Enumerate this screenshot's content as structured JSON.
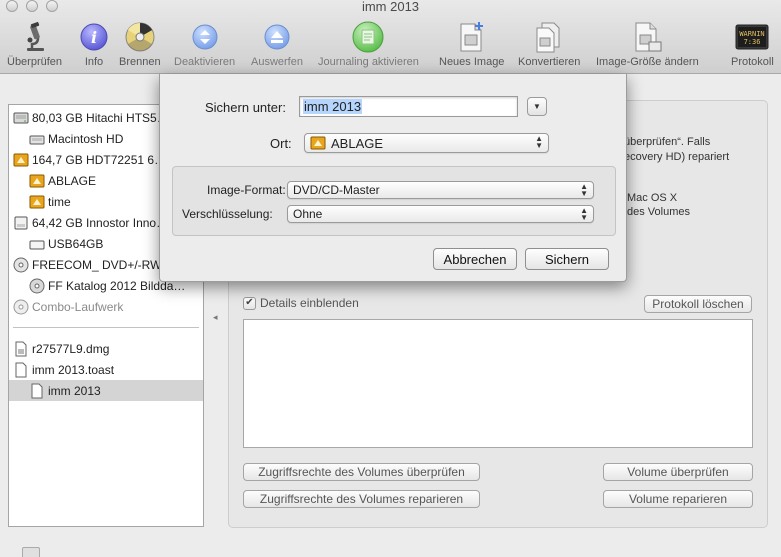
{
  "window": {
    "title": "imm 2013"
  },
  "toolbar": {
    "items": [
      {
        "label": "Überprüfen",
        "icon": "microscope-icon"
      },
      {
        "label": "Info",
        "icon": "info-icon"
      },
      {
        "label": "Brennen",
        "icon": "burn-icon"
      },
      {
        "label": "Deaktivieren",
        "icon": "unmount-icon"
      },
      {
        "label": "Auswerfen",
        "icon": "eject-icon"
      },
      {
        "label": "Journaling aktivieren",
        "icon": "journaling-icon"
      },
      {
        "label": "Neues Image",
        "icon": "new-image-icon"
      },
      {
        "label": "Konvertieren",
        "icon": "convert-icon"
      },
      {
        "label": "Image-Größe ändern",
        "icon": "resize-image-icon"
      },
      {
        "label": "Protokoll",
        "icon": "log-icon",
        "icon_text": "WARNIN\n7:36"
      }
    ]
  },
  "sidebar": {
    "items": [
      {
        "label": "80,03 GB Hitachi HTS5…",
        "icon": "internal-disk-icon"
      },
      {
        "label": "Macintosh HD",
        "icon": "volume-icon"
      },
      {
        "label": "164,7 GB HDT72251 6…",
        "icon": "external-disk-icon"
      },
      {
        "label": "ABLAGE",
        "icon": "external-volume-icon"
      },
      {
        "label": "time",
        "icon": "external-volume-icon"
      },
      {
        "label": "64,42 GB Innostor Inno…",
        "icon": "usb-disk-icon"
      },
      {
        "label": "USB64GB",
        "icon": "volume-icon"
      },
      {
        "label": "FREECOM_ DVD+/-RW…",
        "icon": "optical-drive-icon"
      },
      {
        "label": "FF Katalog 2012 Bildda…",
        "icon": "disc-icon"
      },
      {
        "label": "Combo-Laufwerk",
        "icon": "optical-drive-icon"
      },
      {
        "label": "r27577L9.dmg",
        "icon": "dmg-file-icon"
      },
      {
        "label": "imm 2013.toast",
        "icon": "disk-image-icon"
      },
      {
        "label": "imm 2013",
        "icon": "volume-icon"
      }
    ]
  },
  "main": {
    "background_lines": [
      "überprüfen“. Falls",
      "ecovery HD) repariert",
      "Mac OS X",
      "des Volumes"
    ],
    "details_checkbox": {
      "label": "Details einblenden",
      "checked": true
    },
    "clear_log_button": "Protokoll löschen",
    "buttons": {
      "verify_permissions": "Zugriffsrechte des Volumes überprüfen",
      "repair_permissions": "Zugriffsrechte des Volumes reparieren",
      "verify_volume": "Volume überprüfen",
      "repair_volume": "Volume reparieren"
    }
  },
  "save_sheet": {
    "save_as_label": "Sichern unter:",
    "save_as_value": "imm 2013",
    "location_label": "Ort:",
    "location_value": "ABLAGE",
    "format_label": "Image-Format:",
    "format_value": "DVD/CD-Master",
    "encryption_label": "Verschlüsselung:",
    "encryption_value": "Ohne",
    "cancel_button": "Abbrechen",
    "save_button": "Sichern"
  },
  "colors": {
    "selection": "#d4d4d4",
    "text_selection": "#b5d5fd",
    "external_disk": "#e8a51d"
  }
}
